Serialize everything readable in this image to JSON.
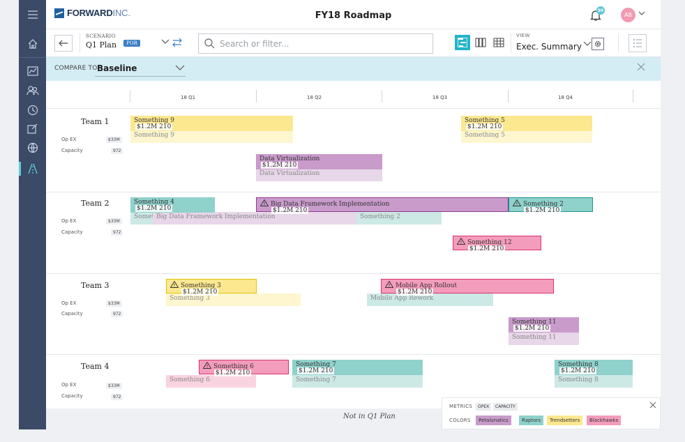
{
  "app": {
    "brand": "FORWARD",
    "brand_suffix": "INC.",
    "title": "FY18 Roadmap",
    "notification_count": "99",
    "avatar_initials": "AB"
  },
  "sidebar": {
    "items": [
      {
        "icon": "menu-icon"
      },
      {
        "icon": "home-icon"
      },
      {
        "icon": "chart-icon"
      },
      {
        "icon": "people-icon"
      },
      {
        "icon": "clock-icon"
      },
      {
        "icon": "edit-icon"
      },
      {
        "icon": "globe-icon"
      },
      {
        "icon": "roadmap-icon",
        "active": true
      }
    ]
  },
  "toolbar": {
    "scenario_label": "SCENARIO",
    "scenario_value": "Q1 Plan",
    "scenario_badge": "POR",
    "search_placeholder": "Search or filter...",
    "view_label": "VIEW",
    "view_value": "Exec. Summary"
  },
  "compare": {
    "label": "COMPARE TO",
    "value": "Baseline"
  },
  "timeline": {
    "quarters": [
      "18 Q1",
      "18 Q2",
      "18 Q3",
      "18 Q4"
    ]
  },
  "lanes": [
    {
      "team": "Team 1",
      "opex_label": "Op EX",
      "opex_value": "$33M",
      "capacity_label": "Capacity",
      "capacity_value": "972",
      "bars": [
        {
          "title": "Something 9",
          "amount": "$1.2M 210",
          "ghost": "Something 9",
          "color": "yellow"
        },
        {
          "title": "Something 5",
          "amount": "$1.2M 210",
          "ghost": "Something 5",
          "color": "yellow"
        },
        {
          "title": "Data Virtualization",
          "amount": "$1.2M 210",
          "ghost": "Data Virtualization",
          "color": "purple"
        }
      ]
    },
    {
      "team": "Team 2",
      "opex_label": "Op EX",
      "opex_value": "$33M",
      "capacity_label": "Capacity",
      "capacity_value": "972",
      "bars": [
        {
          "title": "Something 4",
          "amount": "$1.2M 210",
          "ghost": "Something 4",
          "color": "blue"
        },
        {
          "title": "Big Data Framework Implementation",
          "amount": "$1.2M 210",
          "ghost": "Big Data Framework Implementation",
          "color": "purple",
          "warning": true
        },
        {
          "title": "Something 2",
          "amount": "$1.2M 210",
          "ghost": "Something 2",
          "color": "blue",
          "warning": true
        },
        {
          "title": "Something 12",
          "amount": "$1.2M 210",
          "color": "pink",
          "warning": true
        }
      ]
    },
    {
      "team": "Team 3",
      "opex_label": "Op EX",
      "opex_value": "$33M",
      "capacity_label": "Capacity",
      "capacity_value": "972",
      "bars": [
        {
          "title": "Something 3",
          "amount": "$1.2M 210",
          "ghost": "Something 3",
          "color": "yellow",
          "warning": true
        },
        {
          "title": "Mobile App Rollout",
          "amount": "$1.2M 210",
          "ghost": "Mobile App Rework",
          "color": "pink",
          "warning": true
        },
        {
          "title": "Something 11",
          "amount": "$1.2M 210",
          "ghost": "Something 11",
          "color": "purple"
        }
      ]
    },
    {
      "team": "Team 4",
      "opex_label": "Op EX",
      "opex_value": "$33M",
      "capacity_label": "Capacity",
      "capacity_value": "972",
      "bars": [
        {
          "title": "Something 6",
          "amount": "$1.2M 210",
          "ghost": "Something 6",
          "color": "pink",
          "warning": true
        },
        {
          "title": "Something 7",
          "amount": "$1.2M 210",
          "ghost": "Something 7",
          "color": "blue"
        },
        {
          "title": "Something 8",
          "amount": "$1.2M 210",
          "ghost": "Something 8",
          "color": "blue"
        }
      ]
    }
  ],
  "footer": {
    "not_in_plan": "Not in Q1 Plan"
  },
  "legend": {
    "metrics_label": "METRICS",
    "metrics": [
      "OPEX",
      "CAPACITY"
    ],
    "colors_label": "COLORS",
    "colors": [
      {
        "name": "Petalunatics",
        "hex": "#c99bcb"
      },
      {
        "name": "Raptors",
        "hex": "#8fd1cb"
      },
      {
        "name": "Trendsetters",
        "hex": "#fbe88f"
      },
      {
        "name": "Blackhawks",
        "hex": "#f49cbb"
      }
    ]
  }
}
